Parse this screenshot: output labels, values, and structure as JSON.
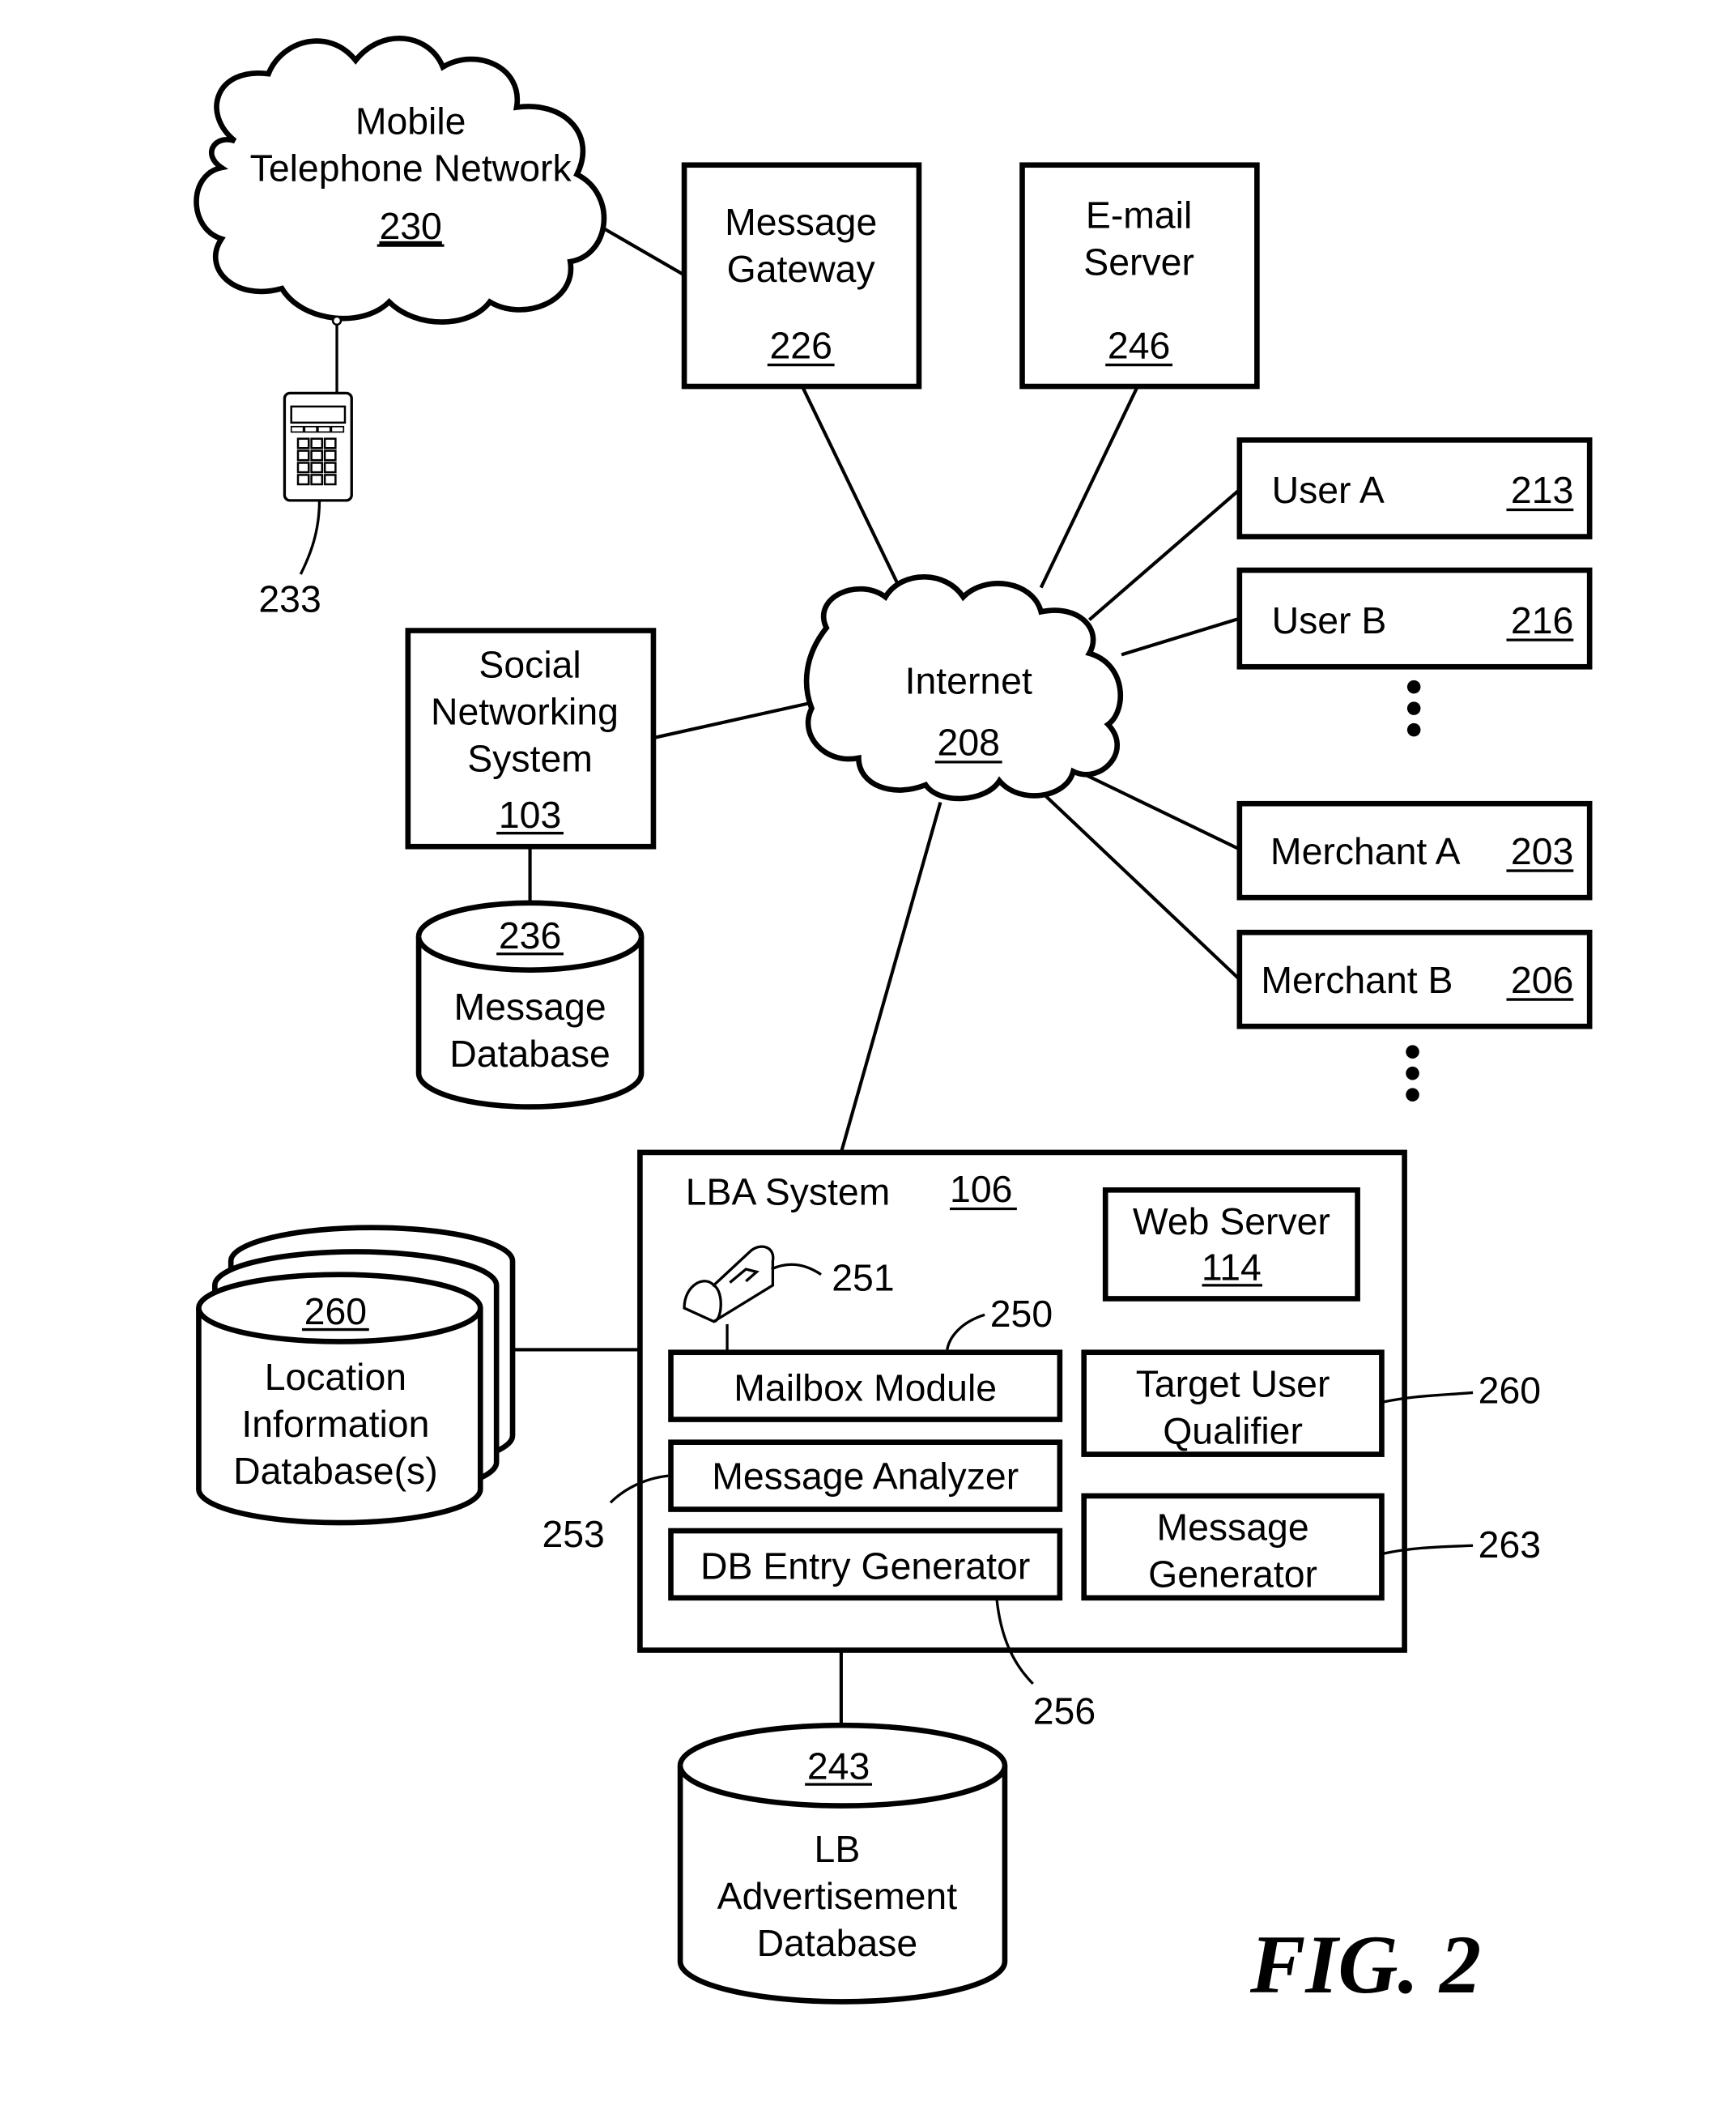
{
  "figure_label": "FIG. 2",
  "nodes": {
    "mobile_network": {
      "line1": "Mobile",
      "line2": "Telephone Network",
      "ref": "230"
    },
    "mobile_device": {
      "ref": "233"
    },
    "message_gateway": {
      "line1": "Message",
      "line2": "Gateway",
      "ref": "226"
    },
    "email_server": {
      "line1": "E-mail",
      "line2": "Server",
      "ref": "246"
    },
    "user_a": {
      "label": "User A",
      "ref": "213"
    },
    "user_b": {
      "label": "User B",
      "ref": "216"
    },
    "internet": {
      "label": "Internet",
      "ref": "208"
    },
    "social_networking": {
      "line1": "Social",
      "line2": "Networking",
      "line3": "System",
      "ref": "103"
    },
    "message_database": {
      "line1": "Message",
      "line2": "Database",
      "ref": "236"
    },
    "merchant_a": {
      "label": "Merchant A",
      "ref": "203"
    },
    "merchant_b": {
      "label": "Merchant B",
      "ref": "206"
    },
    "lba_system": {
      "label": "LBA System",
      "ref": "106",
      "web_server": {
        "line1": "Web Server",
        "ref": "114"
      },
      "mailbox_icon_ref": "251",
      "mailbox_module": {
        "label": "Mailbox Module",
        "ref": "250"
      },
      "message_analyzer": {
        "label": "Message Analyzer",
        "ref": "253"
      },
      "db_entry_generator": {
        "label": "DB Entry Generator",
        "ref": "256"
      },
      "target_user_qualifier": {
        "line1": "Target User",
        "line2": "Qualifier",
        "ref": "260"
      },
      "message_generator": {
        "line1": "Message",
        "line2": "Generator",
        "ref": "263"
      }
    },
    "location_db": {
      "line1": "Location",
      "line2": "Information",
      "line3": "Database(s)",
      "ref": "260"
    },
    "lb_ad_db": {
      "line1": "LB",
      "line2": "Advertisement",
      "line3": "Database",
      "ref": "243"
    }
  }
}
